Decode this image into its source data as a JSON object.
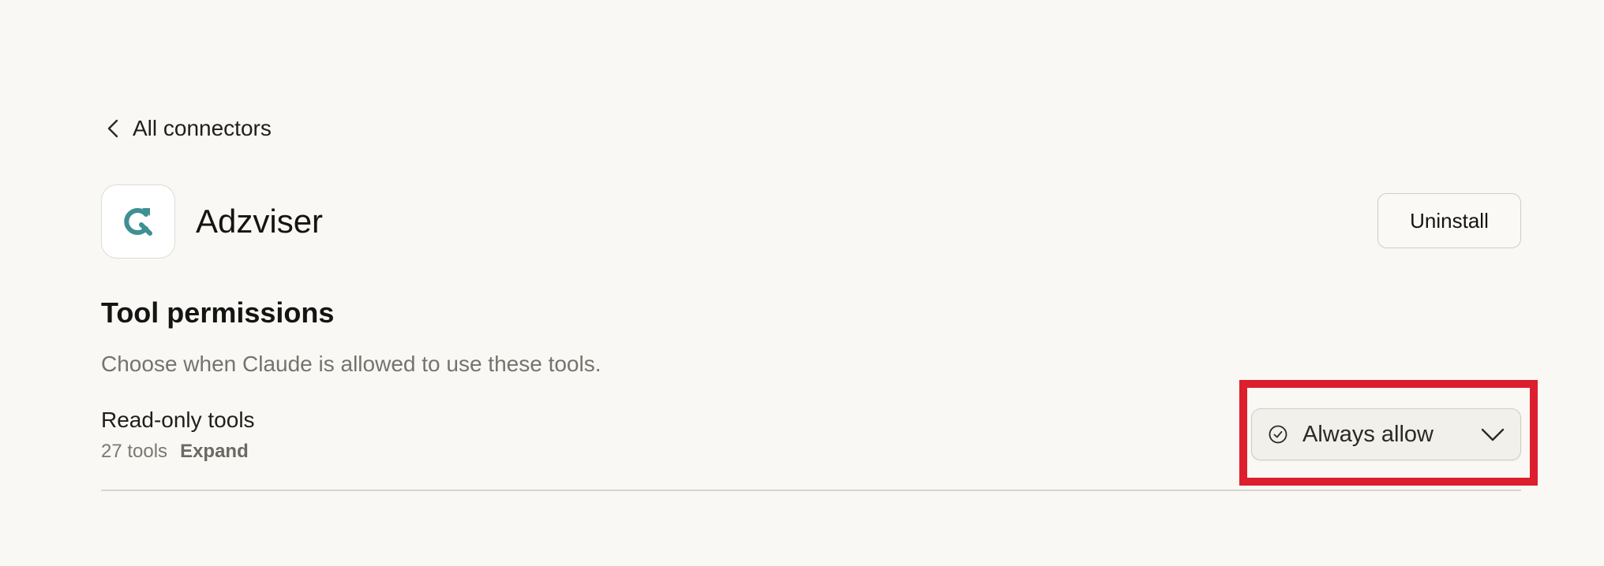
{
  "navigation": {
    "back_label": "All connectors",
    "back_icon": "chevron-left-icon"
  },
  "connector": {
    "name": "Adzviser",
    "logo_icon": "adzviser-logo-icon",
    "logo_color": "#3f8f93",
    "uninstall_label": "Uninstall"
  },
  "permissions": {
    "title": "Tool permissions",
    "description": "Choose when Claude is allowed to use these tools.",
    "groups": [
      {
        "title": "Read-only tools",
        "count_label": "27 tools",
        "expand_label": "Expand",
        "selected_option": "Always allow",
        "option_icon": "check-circle-icon",
        "dropdown_icon": "chevron-down-icon"
      }
    ]
  },
  "annotation": {
    "highlight_color": "#dc1e2d"
  }
}
